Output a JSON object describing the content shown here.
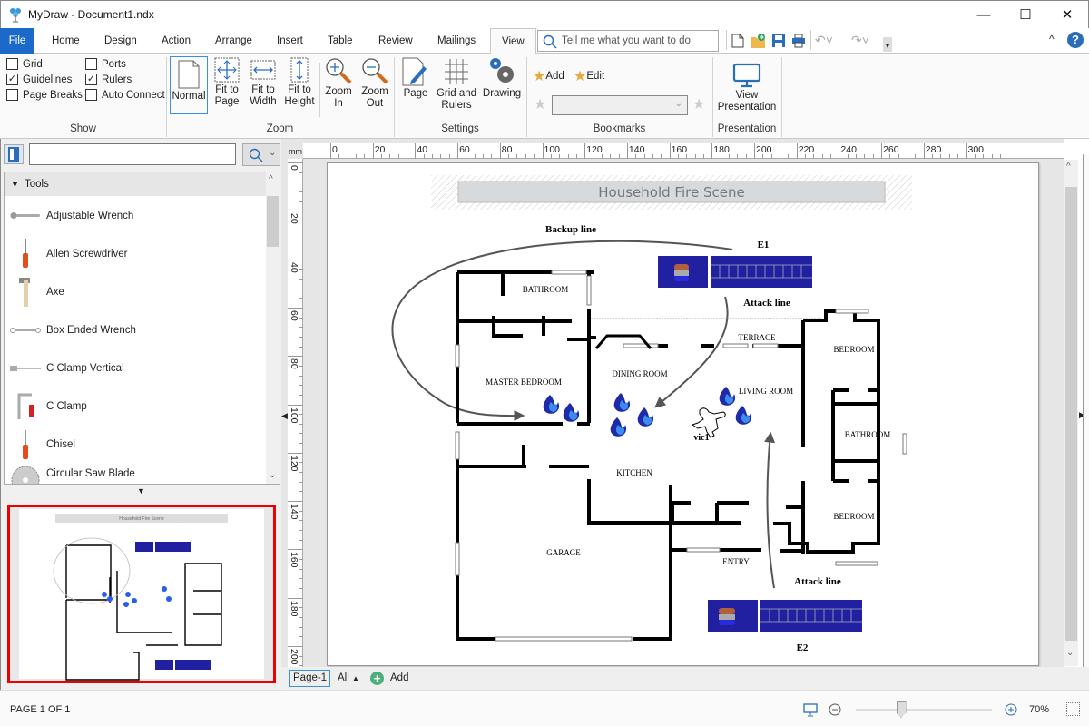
{
  "app": {
    "title": "MyDraw - Document1.ndx",
    "window_controls": {
      "minimize": "—",
      "maximize": "☐",
      "close": "✕"
    }
  },
  "tabs": [
    {
      "label": "File",
      "active": false
    },
    {
      "label": "Home",
      "active": false
    },
    {
      "label": "Design",
      "active": false
    },
    {
      "label": "Action",
      "active": false
    },
    {
      "label": "Arrange",
      "active": false
    },
    {
      "label": "Insert",
      "active": false
    },
    {
      "label": "Table",
      "active": false
    },
    {
      "label": "Review",
      "active": false
    },
    {
      "label": "Mailings",
      "active": false
    },
    {
      "label": "View",
      "active": true
    }
  ],
  "tell_me": {
    "placeholder": "Tell me what you want to do"
  },
  "ribbon": {
    "show": {
      "label": "Show",
      "checkboxes": [
        {
          "label": "Grid",
          "checked": false
        },
        {
          "label": "Guidelines",
          "checked": true
        },
        {
          "label": "Page Breaks",
          "checked": false
        },
        {
          "label": "Ports",
          "checked": false
        },
        {
          "label": "Rulers",
          "checked": true
        },
        {
          "label": "Auto Connect",
          "checked": false
        }
      ]
    },
    "zoom": {
      "label": "Zoom",
      "buttons": [
        {
          "label": "Normal",
          "selected": true
        },
        {
          "label": "Fit to Page"
        },
        {
          "label": "Fit to Width"
        },
        {
          "label": "Fit to Height"
        },
        {
          "label": "Zoom In"
        },
        {
          "label": "Zoom Out"
        }
      ]
    },
    "settings": {
      "label": "Settings",
      "buttons": [
        {
          "label": "Page"
        },
        {
          "label": "Grid and Rulers"
        },
        {
          "label": "Drawing"
        }
      ]
    },
    "bookmarks": {
      "label": "Bookmarks",
      "add_label": "Add",
      "edit_label": "Edit",
      "dropdown_value": ""
    },
    "presentation": {
      "label": "Presentation",
      "view_label": "View Presentation"
    }
  },
  "sidebar": {
    "search_value": "",
    "category": "Tools",
    "items": [
      {
        "label": "Adjustable Wrench",
        "icon": "adjustable-wrench-icon"
      },
      {
        "label": "Allen Screwdriver",
        "icon": "allen-screwdriver-icon"
      },
      {
        "label": "Axe",
        "icon": "axe-icon"
      },
      {
        "label": "Box Ended Wrench",
        "icon": "box-ended-wrench-icon"
      },
      {
        "label": "C Clamp Vertical",
        "icon": "c-clamp-vertical-icon"
      },
      {
        "label": "C Clamp",
        "icon": "c-clamp-icon"
      },
      {
        "label": "Chisel",
        "icon": "chisel-icon"
      },
      {
        "label": "Circular Saw Blade",
        "icon": "circular-saw-blade-icon"
      }
    ]
  },
  "rulers": {
    "unit": "mm",
    "horizontal": [
      "0",
      "20",
      "40",
      "60",
      "80",
      "100",
      "120",
      "140",
      "160",
      "180",
      "200",
      "220",
      "240",
      "260",
      "280",
      "300"
    ],
    "vertical": [
      "0",
      "20",
      "40",
      "60",
      "80",
      "100",
      "120",
      "140",
      "160",
      "180",
      "200"
    ]
  },
  "drawing": {
    "title": "Household Fire Scene",
    "labels": {
      "backup_line": "Backup line",
      "attack_line_1": "Attack line",
      "attack_line_2": "Attack line",
      "engine_1": "E1",
      "engine_2": "E2",
      "victim": "vic1"
    },
    "rooms": [
      {
        "name": "BATHROOM",
        "id": "bathroom-1"
      },
      {
        "name": "MASTER BEDROOM",
        "id": "master-bedroom"
      },
      {
        "name": "DINING ROOM",
        "id": "dining-room"
      },
      {
        "name": "TERRACE",
        "id": "terrace"
      },
      {
        "name": "LIVING ROOM",
        "id": "living-room"
      },
      {
        "name": "KITCHEN",
        "id": "kitchen"
      },
      {
        "name": "BEDROOM",
        "id": "bedroom-1"
      },
      {
        "name": "BATHROOM",
        "id": "bathroom-2"
      },
      {
        "name": "BEDROOM",
        "id": "bedroom-2"
      },
      {
        "name": "GARAGE",
        "id": "garage"
      },
      {
        "name": "ENTRY",
        "id": "entry"
      }
    ],
    "colors": {
      "engine": "#2020a0",
      "flame": "#2a5ee8",
      "wall": "#000000",
      "hose": "#555555"
    }
  },
  "pagebar": {
    "page_tab": "Page-1",
    "all_label": "All",
    "add_label": "Add"
  },
  "status": {
    "page_info": "PAGE 1 OF 1",
    "zoom": "70%",
    "zoom_fraction": 0.33
  }
}
